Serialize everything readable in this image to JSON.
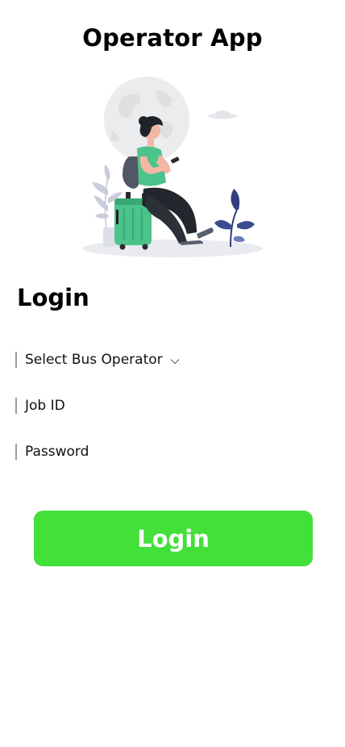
{
  "header": {
    "title": "Operator App"
  },
  "illustration": {
    "name": "traveler-sitting-on-suitcase-illustration"
  },
  "form": {
    "heading": "Login",
    "operator_select": {
      "label": "Select Bus Operator",
      "icon": "chevron-down-icon"
    },
    "job_id": {
      "placeholder": "Job ID"
    },
    "password": {
      "placeholder": "Password"
    },
    "submit_label": "Login"
  },
  "colors": {
    "primary_button": "#43e03a",
    "button_text": "#ffffff",
    "suitcase": "#4cc38a",
    "shirt": "#4cc38a",
    "plant_leaves": "#2f3f7f",
    "globe": "#e6e7ea"
  }
}
